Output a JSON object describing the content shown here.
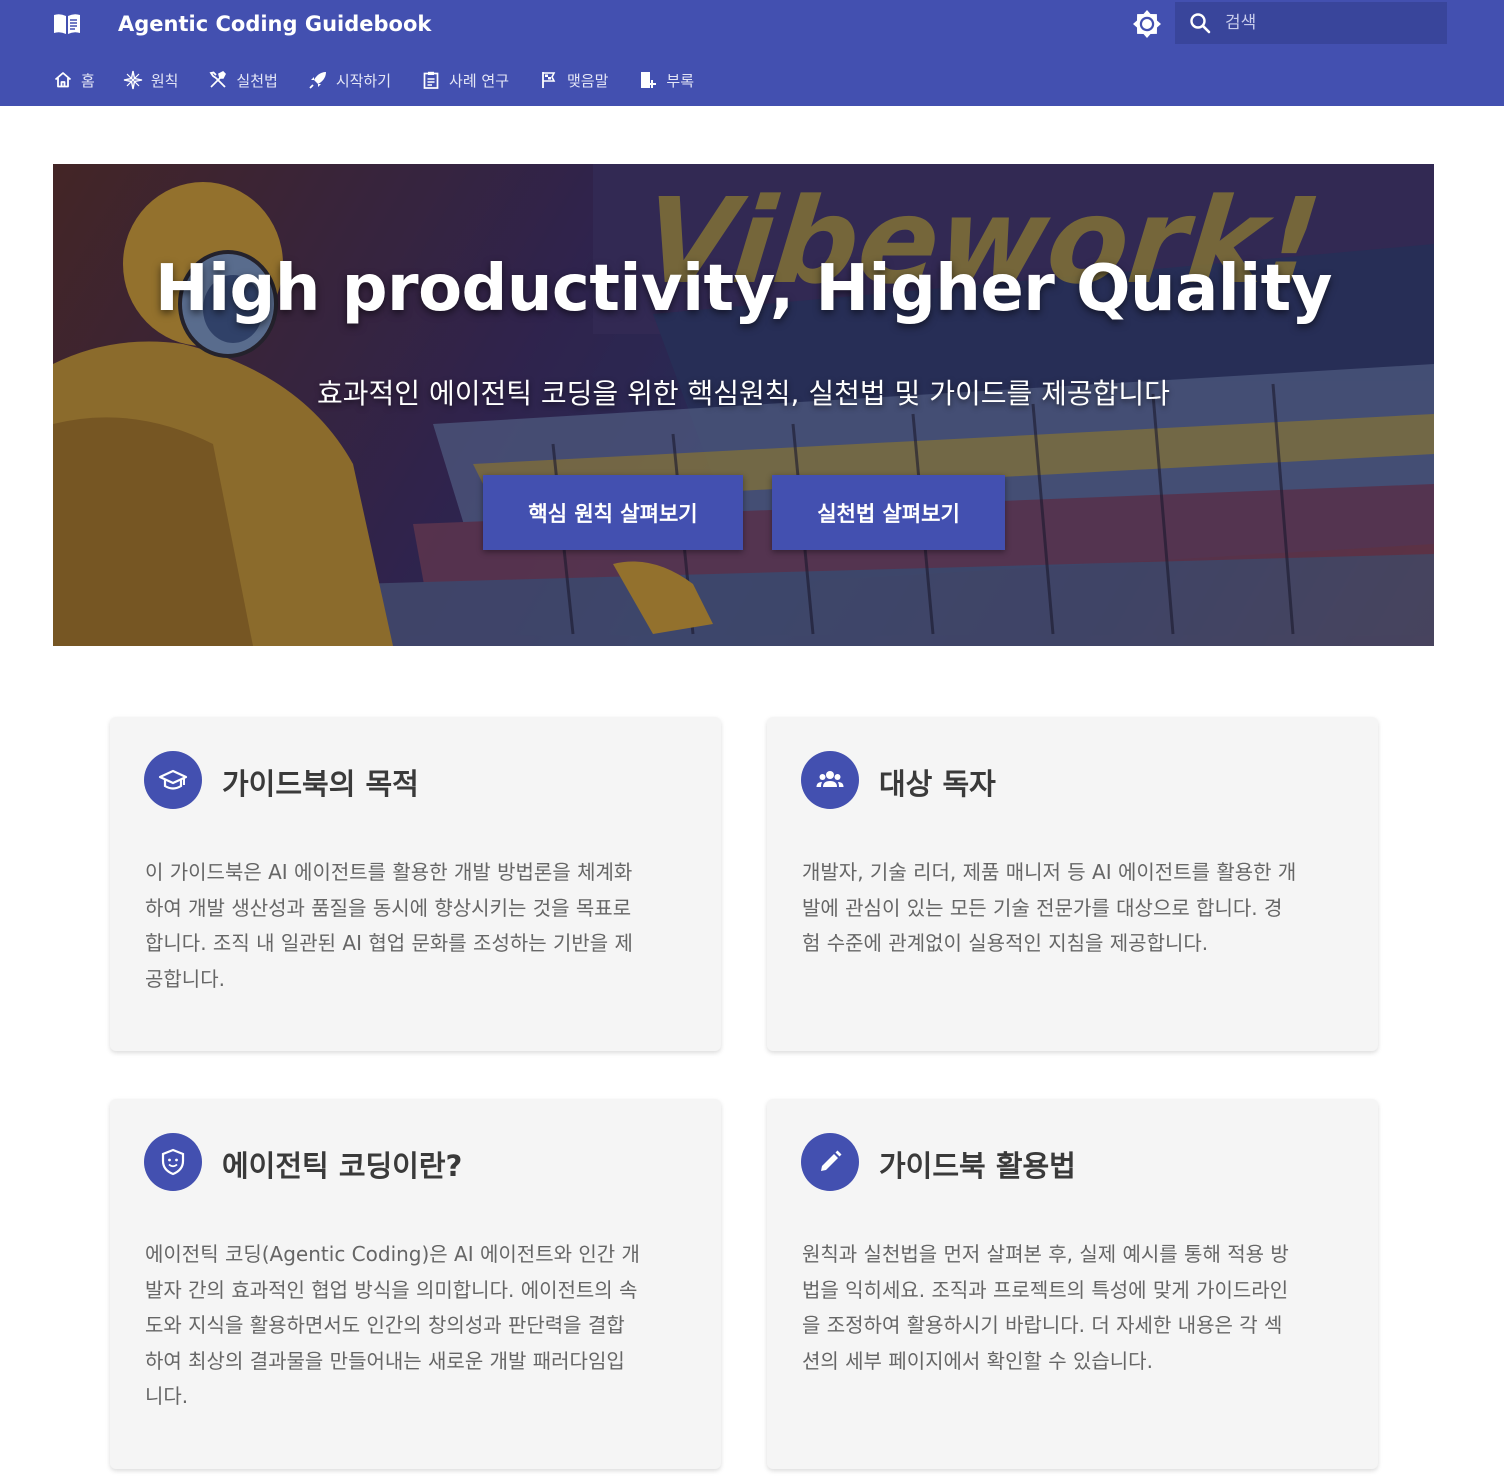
{
  "header": {
    "title": "Agentic Coding Guidebook",
    "logo_icon": "book-open-icon",
    "theme_icon": "brightness-icon",
    "search": {
      "placeholder": "검색",
      "icon": "search-icon"
    }
  },
  "tabs": [
    {
      "label": "홈",
      "icon": "home-icon"
    },
    {
      "label": "원칙",
      "icon": "compass-icon"
    },
    {
      "label": "실천법",
      "icon": "tools-icon"
    },
    {
      "label": "시작하기",
      "icon": "rocket-icon"
    },
    {
      "label": "사례 연구",
      "icon": "clipboard-icon"
    },
    {
      "label": "맺음말",
      "icon": "flag-icon"
    },
    {
      "label": "부록",
      "icon": "book-plus-icon"
    }
  ],
  "hero": {
    "background_text": "Vibework!",
    "title": "High productivity, Higher Quality",
    "subtitle": "효과적인 에이전틱 코딩을 위한 핵심원칙, 실천법 및 가이드를 제공합니다",
    "primary_button": "핵심 원칙 살펴보기",
    "secondary_button": "실천법 살펴보기"
  },
  "cards": [
    {
      "icon": "graduation-cap-icon",
      "title": "가이드북의 목적",
      "lines": [
        "이 가이드북은 AI 에이전트를 활용한 개발 방법론을 체계화",
        "하여 개발 생산성과 품질을 동시에 향상시키는 것을 목표로",
        "합니다. 조직 내 일관된 AI 협업 문화를 조성하는 기반을 제",
        "공합니다."
      ]
    },
    {
      "icon": "users-icon",
      "title": "대상 독자",
      "lines": [
        "개발자, 기술 리더, 제품 매니저 등 AI 에이전트를 활용한 개",
        "발에 관심이 있는 모든 기술 전문가를 대상으로 합니다. 경",
        "험 수준에 관계없이 실용적인 지침을 제공합니다."
      ]
    },
    {
      "icon": "shield-face-icon",
      "title": "에이전틱 코딩이란?",
      "lines": [
        "에이전틱 코딩(Agentic Coding)은 AI 에이전트와 인간 개",
        "발자 간의 효과적인 협업 방식을 의미합니다. 에이전트의 속",
        "도와 지식을 활용하면서도 인간의 창의성과 판단력을 결합",
        "하여 최상의 결과물을 만들어내는 새로운 개발 패러다임입",
        "니다."
      ]
    },
    {
      "icon": "pencil-icon",
      "title": "가이드북 활용법",
      "lines": [
        "원칙과 실천법을 먼저 살펴본 후, 실제 예시를 통해 적용 방",
        "법을 익히세요. 조직과 프로젝트의 특성에 맞게 가이드라인",
        "을 조정하여 활용하시기 바랍니다. 더 자세한 내용은 각 섹",
        "션의 세부 페이지에서 확인할 수 있습니다."
      ]
    }
  ],
  "colors": {
    "primary": "#4350b0",
    "search_bg": "#39459b",
    "card_bg": "#f5f5f5",
    "body_text": "#666666"
  }
}
